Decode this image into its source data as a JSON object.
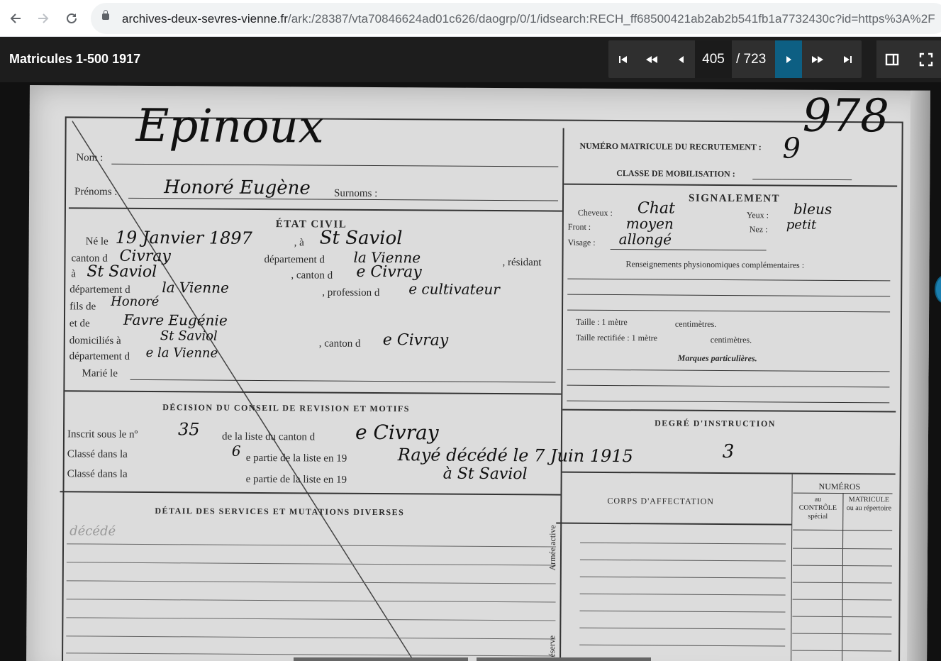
{
  "browser": {
    "url_host": "archives-deux-sevres-vienne.fr",
    "url_path": "/ark:/28387/vta70846624ad01c626/daogrp/0/1/idsearch:RECH_ff68500421ab2ab2b541fb1a7732430c?id=https%3A%2F"
  },
  "viewer": {
    "title": "Matricules 1-500 1917",
    "current_page": "405",
    "total_pages": "/ 723"
  },
  "document": {
    "nom_label": "Nom :",
    "nom": "Epinoux",
    "matricule_number": "978",
    "prenoms_label": "Prénoms :",
    "prenoms": "Honoré Eugène",
    "surnoms_label": "Surnoms :",
    "etat_civil": "ÉTAT CIVIL",
    "ne_le_label": "Né le",
    "ne_le": "19 Janvier 1897",
    "a_label": ", à",
    "lieu_naissance": "St Saviol",
    "canton_label": "canton d",
    "canton": "Civray",
    "departement_label": "département d",
    "departement": "la Vienne",
    "residant_label": ", résidant",
    "a2_label": "à",
    "residence": "St Saviol",
    "canton2_label": ", canton d",
    "canton2": "e Civray",
    "departement2_label": "département d",
    "departement2": "la Vienne",
    "profession_label": ", profession d",
    "profession": "e cultivateur",
    "fils_de_label": "fils de",
    "pere": "Honoré",
    "et_de_label": "et de",
    "mere": "Favre Eugénie",
    "domicilies_label": "domiciliés à",
    "domicile": "St Saviol",
    "canton3_label": ", canton d",
    "canton3": "e Civray",
    "departement3_label": "département d",
    "departement3": "e la Vienne",
    "marie_label": "Marié le",
    "decision_heading": "DÉCISION DU CONSEIL DE REVISION ET MOTIFS",
    "inscrit_label": "Inscrit sous le nº",
    "inscrit_num": "35",
    "liste_label": "de la liste du canton d",
    "liste_canton": "e Civray",
    "classe1_label": "Classé dans la",
    "classe1_num": "6",
    "classe1_suffix": "e partie de la liste en 19",
    "classe2_label": "Classé dans la",
    "classe2_suffix": "e partie de la liste en 19",
    "raye_note": "Rayé décédé le 7 Juin 1915",
    "raye_note2": "à St Saviol",
    "detail_heading": "DÉTAIL DES SERVICES ET MUTATIONS DIVERSES",
    "decede_faint": "décédé",
    "numero_matricule_label": "NUMÉRO MATRICULE DU RECRUTEMENT :",
    "matricule_hand": "9",
    "classe_mobilisation_label": "CLASSE DE MOBILISATION :",
    "signalement_heading": "SIGNALEMENT",
    "cheveux_label": "Cheveux :",
    "cheveux": "Chat",
    "yeux_label": "Yeux :",
    "yeux": "bleus",
    "front_label": "Front :",
    "front": "moyen",
    "nez_label": "Nez :",
    "nez": "petit",
    "visage_label": "Visage :",
    "visage": "allongé",
    "renseignements_label": "Renseignements physionomiques complémentaires :",
    "taille_label": "Taille : 1 mètre",
    "taille_suffix": "centimètres.",
    "taille_rect_label": "Taille rectifiée : 1 mètre",
    "taille_rect_suffix": "centimètres.",
    "marques_label": "Marques particulières.",
    "instruction_heading": "DEGRÉ D'INSTRUCTION",
    "instruction": "3",
    "corps_heading": "CORPS D'AFFECTATION",
    "numeros_heading": "NUMÉROS",
    "col_controle": "au CONTRÔLE spécial",
    "col_matricule": "MATRICULE ou au répertoire",
    "armee_active": "Armée active",
    "reserve": "Réserve"
  },
  "colors": {
    "toolbar_bg": "#1d1d1d",
    "active_button": "#0d5f83",
    "paper": "#dcdcdc"
  }
}
